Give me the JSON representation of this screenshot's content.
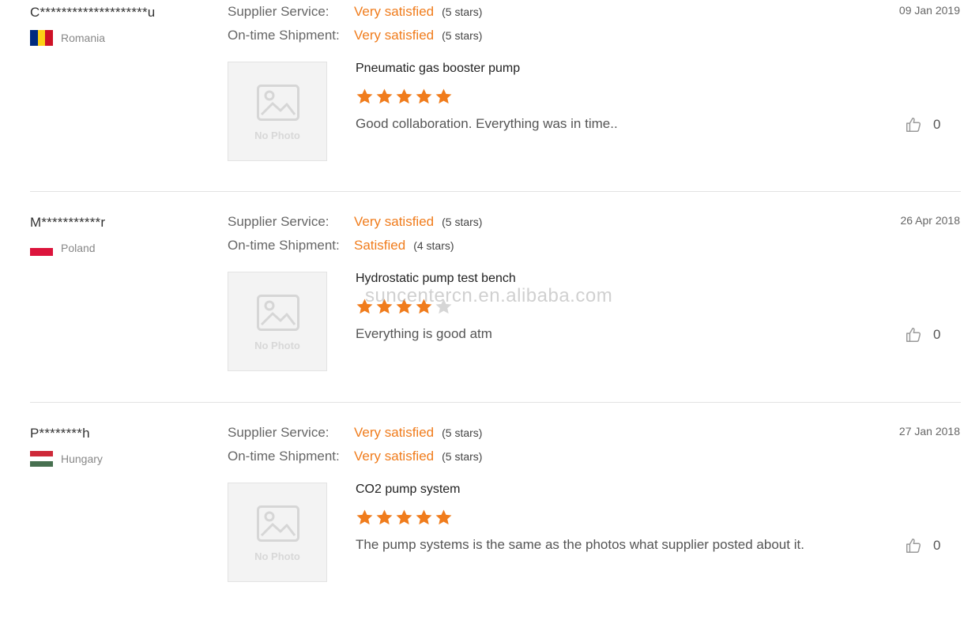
{
  "labels": {
    "supplier_service": "Supplier Service:",
    "ontime_shipment": "On-time Shipment:",
    "no_photo": "No Photo"
  },
  "colors": {
    "accent": "#f07c1c",
    "star_empty": "#d6d6d6"
  },
  "watermark": "suncentercn.en.alibaba.com",
  "reviews": [
    {
      "reviewer": "C********************u",
      "country": "Romania",
      "flag_icon": "romania-flag-icon",
      "date": "09 Jan 2019",
      "supplier_service": {
        "value": "Very satisfied",
        "stars_text": "(5 stars)"
      },
      "ontime_shipment": {
        "value": "Very satisfied",
        "stars_text": "(5 stars)"
      },
      "product": "Pneumatic gas booster pump",
      "rating": 5,
      "text": "Good collaboration. Everything was in time..",
      "likes": "0"
    },
    {
      "reviewer": "M***********r",
      "country": "Poland",
      "flag_icon": "poland-flag-icon",
      "date": "26 Apr 2018",
      "supplier_service": {
        "value": "Very satisfied",
        "stars_text": "(5 stars)"
      },
      "ontime_shipment": {
        "value": "Satisfied",
        "stars_text": "(4 stars)"
      },
      "product": "Hydrostatic pump test bench",
      "rating": 4,
      "text": "Everything is good atm",
      "likes": "0"
    },
    {
      "reviewer": "P********h",
      "country": "Hungary",
      "flag_icon": "hungary-flag-icon",
      "date": "27 Jan 2018",
      "supplier_service": {
        "value": "Very satisfied",
        "stars_text": "(5 stars)"
      },
      "ontime_shipment": {
        "value": "Very satisfied",
        "stars_text": "(5 stars)"
      },
      "product": "CO2 pump system",
      "rating": 5,
      "text": "The pump systems is the same as the photos what supplier posted about it.",
      "likes": "0"
    }
  ]
}
